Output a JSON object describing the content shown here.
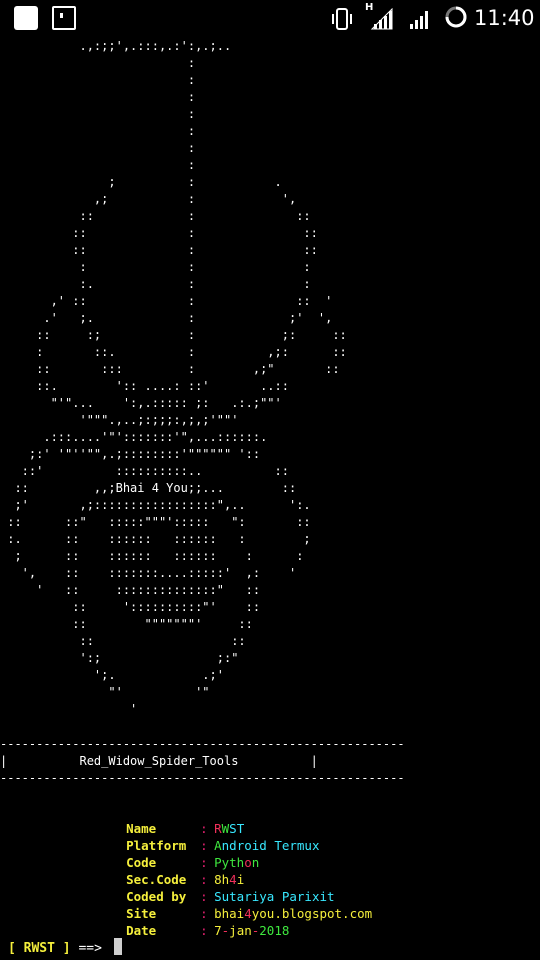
{
  "statusbar": {
    "time": "11:40",
    "network_letter": "H"
  },
  "banner": {
    "separator": "--------------------------------------------------------",
    "title_line": "|          Red_Widow_Spider_Tools          |"
  },
  "info": {
    "name_label": "Name",
    "name_value_1": "R",
    "name_value_2": "W",
    "name_value_3": "ST",
    "platform_label": "Platform",
    "platform_value_1": "A",
    "platform_value_2": "ndroid Termux",
    "code_label": "Code",
    "code_value_1": "Pyth",
    "code_value_2": "o",
    "code_value_3": "n",
    "seccode_label": "Sec.Code",
    "seccode_value_1": "8h",
    "seccode_value_2": "4",
    "seccode_value_3": "i",
    "codedby_label": "Coded by",
    "codedby_value": "Sutariya Parixit",
    "site_label": "Site",
    "site_value_1": "bhai",
    "site_value_2": "4",
    "site_value_3": "you.blogspot.com",
    "date_label": "Date",
    "date_value_1": "7",
    "date_value_2": "-",
    "date_value_3": "jan",
    "date_value_4": "-",
    "date_value_5": "2018",
    "colon": ":"
  },
  "prompt": {
    "text": "[ RWST ]",
    "arrow": " ==> "
  },
  "art": {
    "center_label": ",;Bhai 4 You;;..."
  }
}
